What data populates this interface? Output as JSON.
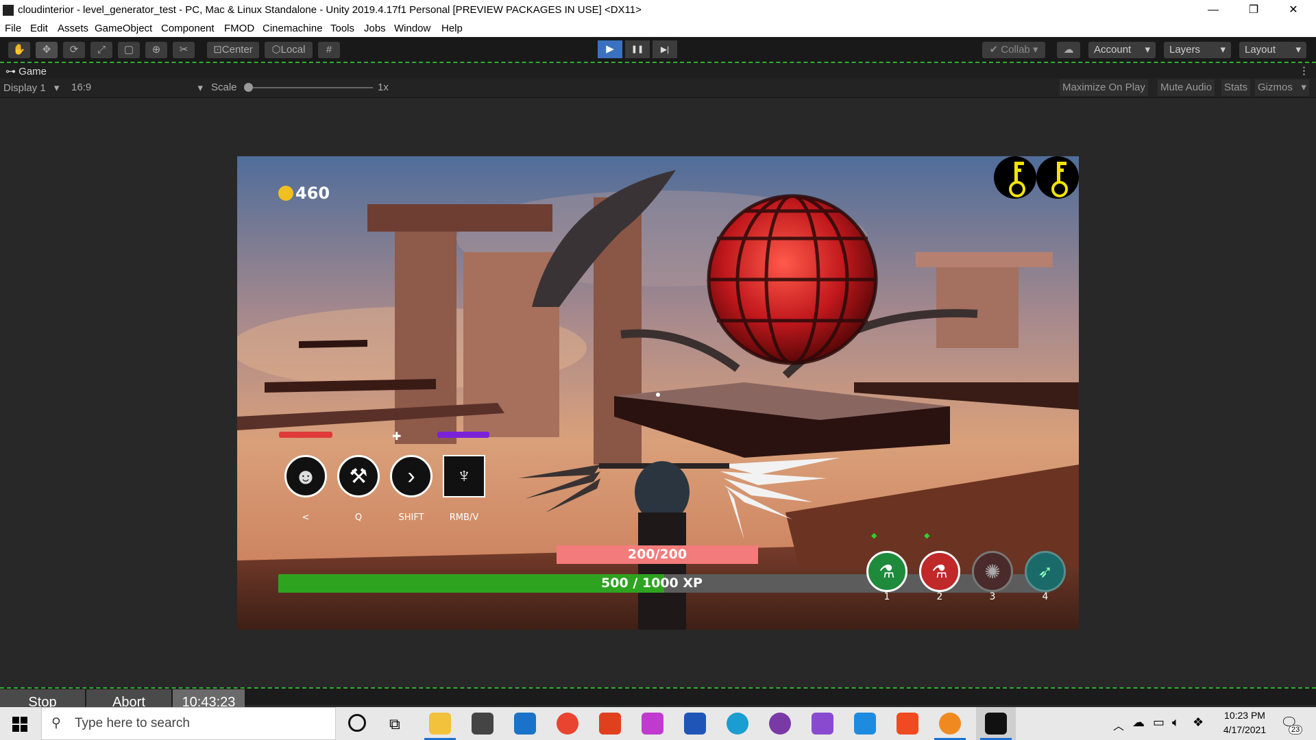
{
  "window": {
    "title": "cloudinterior - level_generator_test - PC, Mac & Linux Standalone - Unity 2019.4.17f1 Personal [PREVIEW PACKAGES IN USE] <DX11>",
    "minimize": "—",
    "maximize": "❐",
    "close": "✕"
  },
  "menu": [
    "File",
    "Edit",
    "Assets",
    "GameObject",
    "Component",
    "FMOD",
    "Cinemachine",
    "Tools",
    "Jobs",
    "Window",
    "Help"
  ],
  "toolbar": {
    "tools": [
      "hand-icon",
      "move-icon",
      "rotate-icon",
      "scale-icon",
      "rect-icon",
      "transform-icon",
      "custom-tool-icon"
    ],
    "pivot": "Center",
    "space": "Local",
    "play": "▶",
    "pause": "❚❚",
    "step": "▶|",
    "collab": "Collab",
    "account": "Account",
    "layers": "Layers",
    "layout": "Layout"
  },
  "game_tab": {
    "label": "Game",
    "display": "Display 1",
    "aspect": "16:9",
    "scale_label": "Scale",
    "scale_value": "1x",
    "scale_level": 0.0,
    "buttons": [
      "Maximize On Play",
      "Mute Audio",
      "Stats",
      "Gizmos"
    ]
  },
  "game_hud": {
    "coins": "460",
    "keys_count": 2,
    "health_bar_color": "#e03a3a",
    "mana_bar_color": "#7a22d8",
    "abilities": [
      {
        "key": "<",
        "icon": "lion-icon"
      },
      {
        "key": "Q",
        "icon": "pickaxe-icon"
      },
      {
        "key": "SHIFT",
        "icon": "dash-arrow-icon"
      },
      {
        "key": "RMB/V",
        "icon": "wings-icon"
      }
    ],
    "boss_health": "200/200",
    "boss_health_fraction": 1.0,
    "xp_text": "500 / 1000 XP",
    "xp_fraction": 0.5,
    "spells": [
      {
        "number": "1",
        "color": "#1e8a3c",
        "icon": "potion-icon",
        "ready": true
      },
      {
        "number": "2",
        "color": "#c0282a",
        "icon": "potion-icon",
        "ready": true
      },
      {
        "number": "3",
        "color": "#4a2a2a",
        "icon": "burst-icon",
        "ready": false
      },
      {
        "number": "4",
        "color": "#1a6a6a",
        "icon": "feather-icon",
        "ready": false
      }
    ]
  },
  "run_controls": {
    "stop": "Stop",
    "abort": "Abort",
    "timer": "10:43:23"
  },
  "taskbar": {
    "search_placeholder": "Type here to search",
    "time": "10:23 PM",
    "date": "4/17/2021",
    "notification_count": "23",
    "apps": [
      "task-view-icon",
      "file-explorer-icon",
      "store-icon",
      "mail-icon",
      "chrome-icon",
      "office-icon",
      "snip-icon",
      "word-icon",
      "edge-icon",
      "github-icon",
      "visual-studio-icon",
      "vscode-icon",
      "brave-icon",
      "firefox-icon",
      "unity-icon"
    ]
  }
}
